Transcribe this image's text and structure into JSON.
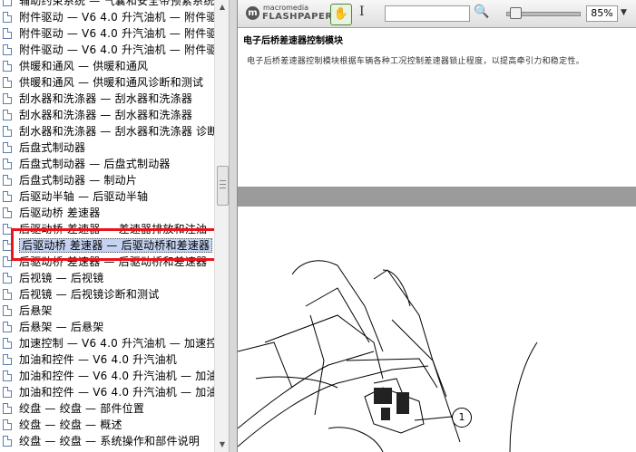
{
  "sidebar": {
    "items": [
      {
        "label": "辅助约束系统 — 气囊和安全带预紧系统"
      },
      {
        "label": "附件驱动 — V6 4.0 升汽油机 — 附件驱"
      },
      {
        "label": "附件驱动 — V6 4.0 升汽油机 — 附件驱"
      },
      {
        "label": "附件驱动 — V6 4.0 升汽油机 — 附件驱"
      },
      {
        "label": "供暖和通风 — 供暖和通风"
      },
      {
        "label": "供暖和通风 — 供暖和通风诊断和测试"
      },
      {
        "label": "刮水器和洗涤器 — 刮水器和洗涤器"
      },
      {
        "label": "刮水器和洗涤器 — 刮水器和洗涤器"
      },
      {
        "label": "刮水器和洗涤器 — 刮水器和洗涤器 诊断"
      },
      {
        "label": "后盘式制动器"
      },
      {
        "label": "后盘式制动器 — 后盘式制动器"
      },
      {
        "label": "后盘式制动器 — 制动片"
      },
      {
        "label": "后驱动半轴 — 后驱动半轴"
      },
      {
        "label": "后驱动桥 差速器"
      },
      {
        "label": "后驱动桥 差速器 — 差速器排放和注油"
      },
      {
        "label": "后驱动桥 差速器 — 后驱动桥和差速器",
        "selected": true
      },
      {
        "label": "后驱动桥 差速器 — 后驱动桥和差速器"
      },
      {
        "label": "后视镜 — 后视镜"
      },
      {
        "label": "后视镜 — 后视镜诊断和测试"
      },
      {
        "label": "后悬架"
      },
      {
        "label": "后悬架 — 后悬架"
      },
      {
        "label": "加速控制 — V6 4.0 升汽油机 — 加速控"
      },
      {
        "label": "加油和控件 — V6 4.0 升汽油机"
      },
      {
        "label": "加油和控件 — V6 4.0 升汽油机 — 加油"
      },
      {
        "label": "加油和控件 — V6 4.0 升汽油机 — 加油"
      },
      {
        "label": "绞盘 — 绞盘 — 部件位置"
      },
      {
        "label": "绞盘 — 绞盘 — 概述"
      },
      {
        "label": "绞盘 — 绞盘 — 系统操作和部件说明"
      }
    ]
  },
  "viewer": {
    "logo_small": "macromedia",
    "logo_big": "FLASHPAPER",
    "search_value": "",
    "zoom": "85%",
    "page_title": "电子后桥差速器控制模块",
    "page_text": "电子后桥差速器控制模块根据车辆各种工况控制差速器锁止程度，以提高牵引力和稳定性。",
    "callout": "1"
  },
  "colors": {
    "highlight": "#e8151b",
    "selection": "#c5d3f0",
    "page_gap": "#9b9b9b"
  }
}
